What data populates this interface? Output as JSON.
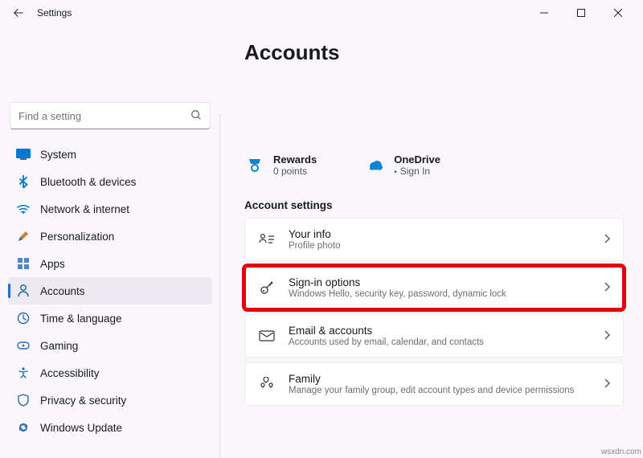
{
  "window": {
    "title": "Settings"
  },
  "search": {
    "placeholder": "Find a setting"
  },
  "sidebar": {
    "items": [
      {
        "label": "System"
      },
      {
        "label": "Bluetooth & devices"
      },
      {
        "label": "Network & internet"
      },
      {
        "label": "Personalization"
      },
      {
        "label": "Apps"
      },
      {
        "label": "Accounts"
      },
      {
        "label": "Time & language"
      },
      {
        "label": "Gaming"
      },
      {
        "label": "Accessibility"
      },
      {
        "label": "Privacy & security"
      },
      {
        "label": "Windows Update"
      }
    ]
  },
  "main": {
    "title": "Accounts",
    "rewards": {
      "title": "Rewards",
      "sub": "0 points"
    },
    "onedrive": {
      "title": "OneDrive",
      "sub": "Sign In"
    },
    "section_heading": "Account settings",
    "rows": [
      {
        "title": "Your info",
        "sub": "Profile photo"
      },
      {
        "title": "Sign-in options",
        "sub": "Windows Hello, security key, password, dynamic lock"
      },
      {
        "title": "Email & accounts",
        "sub": "Accounts used by email, calendar, and contacts"
      },
      {
        "title": "Family",
        "sub": "Manage your family group, edit account types and device permissions"
      }
    ]
  },
  "watermark": "wsxdn.com"
}
